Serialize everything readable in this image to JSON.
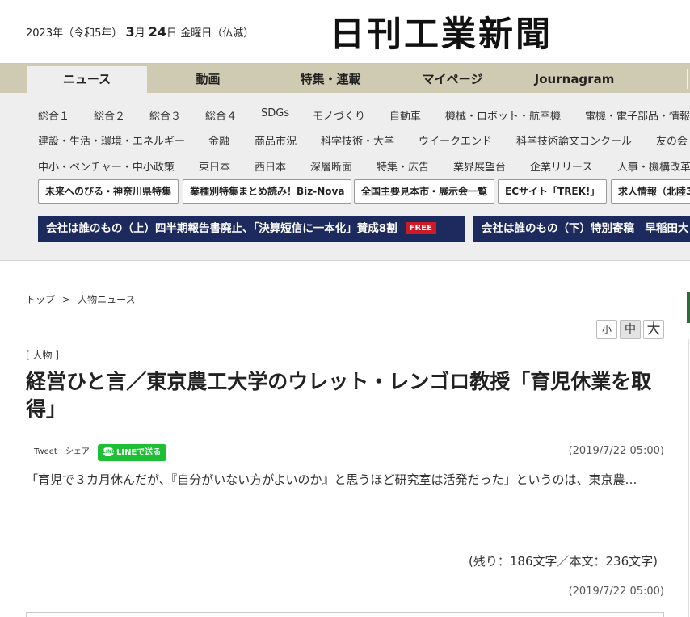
{
  "header": {
    "date_prefix": "2023年（令和5年）",
    "month": "3",
    "month_unit": "月",
    "day": "24",
    "day_unit": "日",
    "weekday": "金曜日（仏滅）",
    "logo": "日刊工業新聞"
  },
  "main_nav": {
    "tabs": [
      "ニュース",
      "動画",
      "特集・連載",
      "マイページ",
      "Journagram"
    ],
    "active": "ニュース"
  },
  "sub_nav": {
    "row1": [
      "総合１",
      "総合２",
      "総合３",
      "総合４",
      "SDGs",
      "モノづくり",
      "自動車",
      "機械・ロボット・航空機",
      "電機・電子部品・情報"
    ],
    "row2": [
      "建設・生活・環境・エネルギー",
      "金融",
      "商品市況",
      "科学技術・大学",
      "ウイークエンド",
      "科学技術論文コンクール",
      "友の会"
    ],
    "row3": [
      "中小・ベンチャー・中小政策",
      "東日本",
      "西日本",
      "深層断面",
      "特集・広告",
      "業界展望台",
      "企業リリース",
      "人事・機構改革"
    ]
  },
  "feature_buttons": [
    "未来へのびる・神奈川県特集",
    "業種別特集まとめ読み！Biz-Nova",
    "全国主要見本市・展示会一覧",
    "ECサイト「TREK!」",
    "求人情報（北陸3"
  ],
  "banners": [
    {
      "text": "会社は誰のもの（上）四半期報告書廃止、「決算短信に一本化」賛成8割",
      "badge": "FREE"
    },
    {
      "text": "会社は誰のもの（下）特別寄稿　早稲田大"
    }
  ],
  "breadcrumb": {
    "top": "トップ",
    "separator": ">",
    "current": "人物ニュース"
  },
  "font_size": {
    "small": "小",
    "medium": "中",
    "large": "大"
  },
  "article": {
    "category": "[ 人物 ]",
    "title": "経営ひと言／東京農工大学のウレット・レンゴロ教授「育児休業を取得」",
    "share": {
      "tweet": "Tweet",
      "share": "シェア",
      "line": "LINEで送る",
      "line_icon_text": "LINE"
    },
    "timestamp": "(2019/7/22 05:00)",
    "body": "「育児で３カ月休んだが、『自分がいない方がよいのか』と思うほど研究室は活発だった」というのは、東京農…",
    "counts": "(残り：186文字／本文：236文字)",
    "timestamp_bottom": "(2019/7/22 05:00)"
  },
  "colors": {
    "nav_bg": "#cfcbb2",
    "subnav_bg": "#eeeeee",
    "banner_bg": "#1d2a5d",
    "free_badge": "#cc1b25",
    "line_green": "#1dc034"
  }
}
